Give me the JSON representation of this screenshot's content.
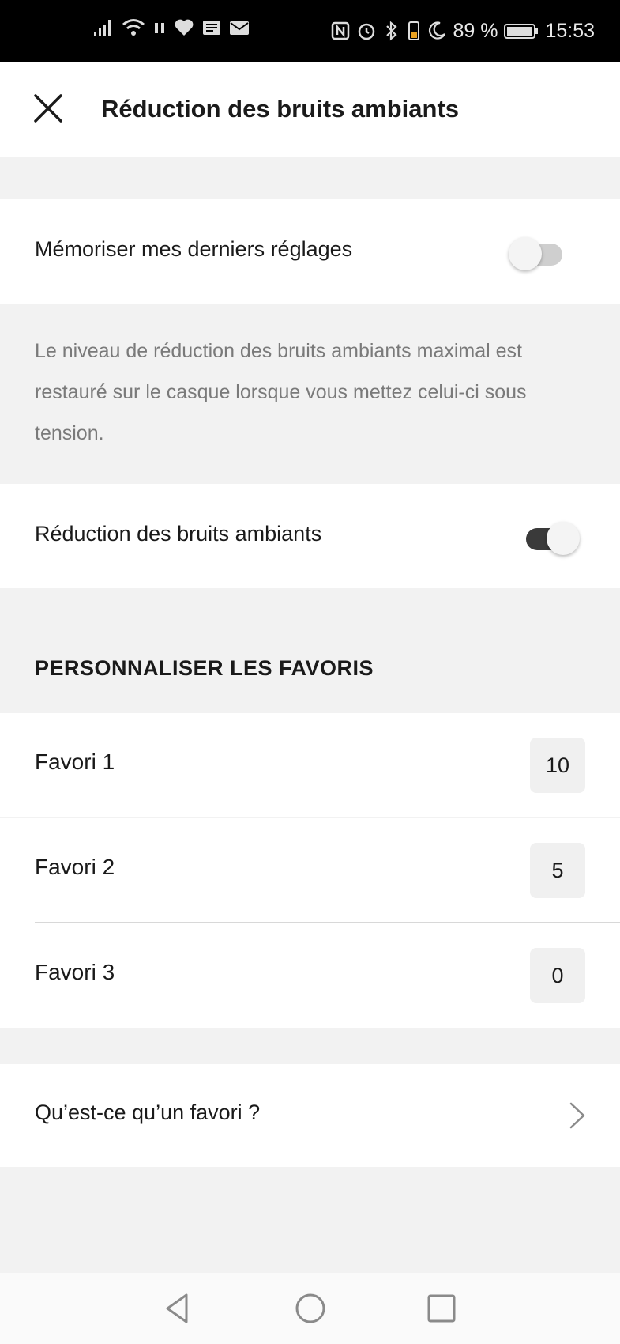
{
  "status_bar": {
    "battery_percent": "89 %",
    "time": "15:53",
    "left_icons": [
      "signal-icon",
      "wifi-icon",
      "pause-icon",
      "heart-icon",
      "news-icon",
      "mail-icon"
    ],
    "right_icons": [
      "nfc-icon",
      "alarm-icon",
      "bluetooth-icon",
      "vibrate-icon",
      "moon-icon",
      "battery-icon"
    ]
  },
  "header": {
    "title": "Réduction des bruits ambiants",
    "close_icon": "close-icon"
  },
  "settings": {
    "remember_label": "Mémoriser mes derniers réglages",
    "remember_on": false,
    "description": "Le niveau de réduction des bruits ambiants maximal est restauré sur le casque lorsque vous mettez celui-ci sous tension.",
    "noise_reduction_label": "Réduction des bruits ambiants",
    "noise_reduction_on": true
  },
  "favorites": {
    "section_title": "PERSONNALISER LES FAVORIS",
    "items": [
      {
        "label": "Favori 1",
        "value": "10"
      },
      {
        "label": "Favori 2",
        "value": "5"
      },
      {
        "label": "Favori 3",
        "value": "0"
      }
    ]
  },
  "help": {
    "label": "Qu’est-ce qu’un favori ?",
    "icon": "chevron-right-icon"
  },
  "colors": {
    "toggle_on_track": "#3a3a3a",
    "toggle_off_track": "#cfcfcf",
    "background": "#f2f2f2"
  }
}
